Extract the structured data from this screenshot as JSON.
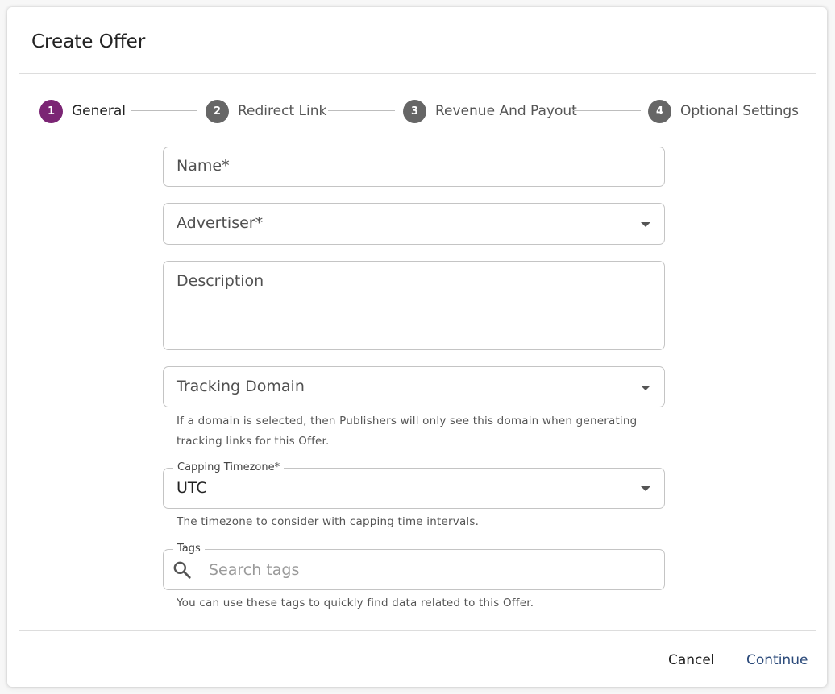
{
  "dialog": {
    "title": "Create Offer"
  },
  "stepper": {
    "steps": [
      {
        "number": "1",
        "label": "General",
        "active": true
      },
      {
        "number": "2",
        "label": "Redirect Link",
        "active": false
      },
      {
        "number": "3",
        "label": "Revenue And Payout",
        "active": false
      },
      {
        "number": "4",
        "label": "Optional Settings",
        "active": false
      }
    ]
  },
  "form": {
    "name": {
      "placeholder": "Name",
      "required_mark": "*"
    },
    "advertiser": {
      "placeholder": "Advertiser",
      "required_mark": "*"
    },
    "description": {
      "placeholder": "Description"
    },
    "tracking_domain": {
      "placeholder": "Tracking Domain",
      "helper": "If a domain is selected, then Publishers will only see this domain when generating tracking links for this Offer."
    },
    "capping_timezone": {
      "label": "Capping Timezone",
      "required_mark": "*",
      "value": "UTC",
      "helper": "The timezone to consider with capping time intervals."
    },
    "tags": {
      "label": "Tags",
      "placeholder": "Search tags",
      "helper": "You can use these tags to quickly find data related to this Offer."
    }
  },
  "footer": {
    "cancel_label": "Cancel",
    "continue_label": "Continue"
  },
  "colors": {
    "accent": "#7b2574",
    "inactive_step": "#666666",
    "continue_text": "#2b4a7a"
  },
  "icons": {
    "search": "search-icon",
    "dropdown": "chevron-down-icon"
  }
}
